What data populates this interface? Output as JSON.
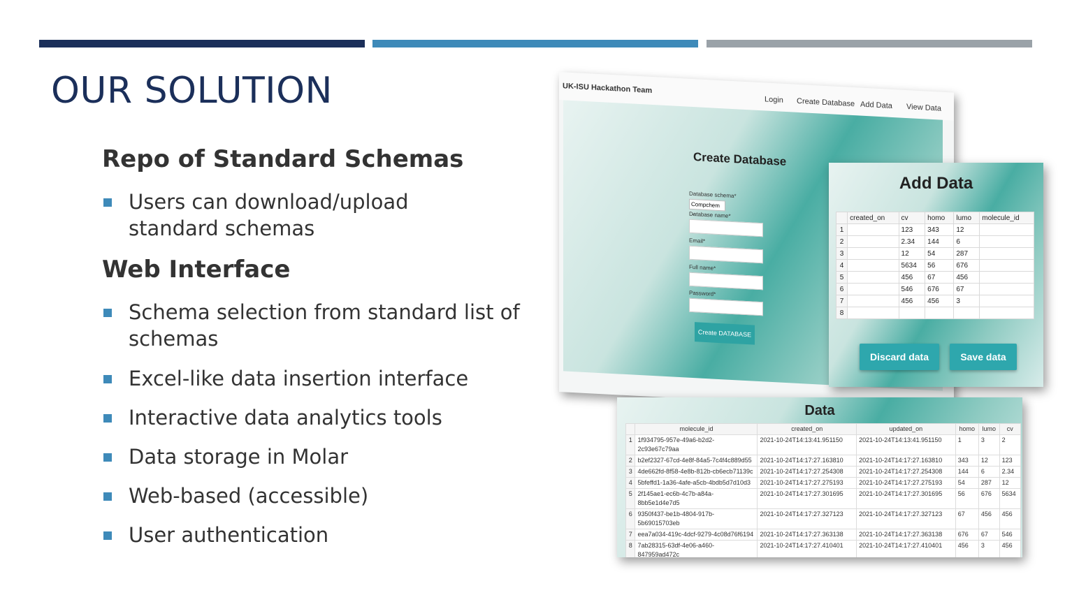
{
  "slide": {
    "title": "OUR SOLUTION",
    "accent_colors": [
      "#1b2f5a",
      "#3e8ab9",
      "#9aa2a8"
    ],
    "section1": {
      "heading": "Repo of Standard Schemas",
      "bullets": [
        [
          "Users can download/upload",
          "standard schemas"
        ]
      ]
    },
    "section2": {
      "heading": "Web Interface",
      "bullets": [
        [
          "Schema selection from standard list of",
          "schemas"
        ],
        [
          "Excel-like data insertion interface"
        ],
        [
          "Interactive data analytics tools"
        ],
        [
          "Data storage in Molar"
        ],
        [
          "Web-based (accessible)"
        ],
        [
          "User authentication"
        ]
      ]
    }
  },
  "create_db": {
    "brand": "UK-ISU Hackathon Team",
    "nav": [
      "Login",
      "Create Database",
      "Add Data",
      "View Data"
    ],
    "title": "Create Database",
    "schema_label": "Database schema*",
    "schema_value": "Compchem",
    "name_label": "Database name*",
    "email_label": "Email*",
    "fullname_label": "Full name*",
    "password_label": "Password*",
    "submit": "Create DATABASE"
  },
  "add_data": {
    "title": "Add Data",
    "columns": [
      "",
      "created_on",
      "cv",
      "homo",
      "lumo",
      "molecule_id"
    ],
    "rows": [
      [
        "1",
        "",
        "123",
        "343",
        "12",
        ""
      ],
      [
        "2",
        "",
        "2.34",
        "144",
        "6",
        ""
      ],
      [
        "3",
        "",
        "12",
        "54",
        "287",
        ""
      ],
      [
        "4",
        "",
        "5634",
        "56",
        "676",
        ""
      ],
      [
        "5",
        "",
        "456",
        "67",
        "456",
        ""
      ],
      [
        "6",
        "",
        "546",
        "676",
        "67",
        ""
      ],
      [
        "7",
        "",
        "456",
        "456",
        "3",
        ""
      ],
      [
        "8",
        "",
        "",
        "",
        "",
        ""
      ]
    ],
    "discard": "Discard data",
    "save": "Save data"
  },
  "data_view": {
    "title": "Data",
    "columns": [
      "",
      "molecule_id",
      "created_on",
      "updated_on",
      "homo",
      "lumo",
      "cv"
    ],
    "rows": [
      [
        "1",
        "1f934795-957e-49a6-b2d2-2c93e67c79aa",
        "2021-10-24T14:13:41.951150",
        "2021-10-24T14:13:41.951150",
        "1",
        "3",
        "2"
      ],
      [
        "2",
        "b2ef2327-67cd-4e8f-84a5-7c4f4c889d55",
        "2021-10-24T14:17:27.163810",
        "2021-10-24T14:17:27.163810",
        "343",
        "12",
        "123"
      ],
      [
        "3",
        "4de662fd-8f58-4e8b-812b-cb6ecb71139c",
        "2021-10-24T14:17:27.254308",
        "2021-10-24T14:17:27.254308",
        "144",
        "6",
        "2.34"
      ],
      [
        "4",
        "5bfeffd1-1a36-4afe-a5cb-4bdb5d7d10d3",
        "2021-10-24T14:17:27.275193",
        "2021-10-24T14:17:27.275193",
        "54",
        "287",
        "12"
      ],
      [
        "5",
        "2f145ae1-ec6b-4c7b-a84a-8bb5e1d4e7d5",
        "2021-10-24T14:17:27.301695",
        "2021-10-24T14:17:27.301695",
        "56",
        "676",
        "5634"
      ],
      [
        "6",
        "9350f437-be1b-4804-917b-5b69015703eb",
        "2021-10-24T14:17:27.327123",
        "2021-10-24T14:17:27.327123",
        "67",
        "456",
        "456"
      ],
      [
        "7",
        "eea7a034-419c-4dcf-9279-4c08d76f6194",
        "2021-10-24T14:17:27.363138",
        "2021-10-24T14:17:27.363138",
        "676",
        "67",
        "546"
      ],
      [
        "8",
        "7ab28315-63df-4e06-a460-847959ad472c",
        "2021-10-24T14:17:27.410401",
        "2021-10-24T14:17:27.410401",
        "456",
        "3",
        "456"
      ]
    ]
  }
}
